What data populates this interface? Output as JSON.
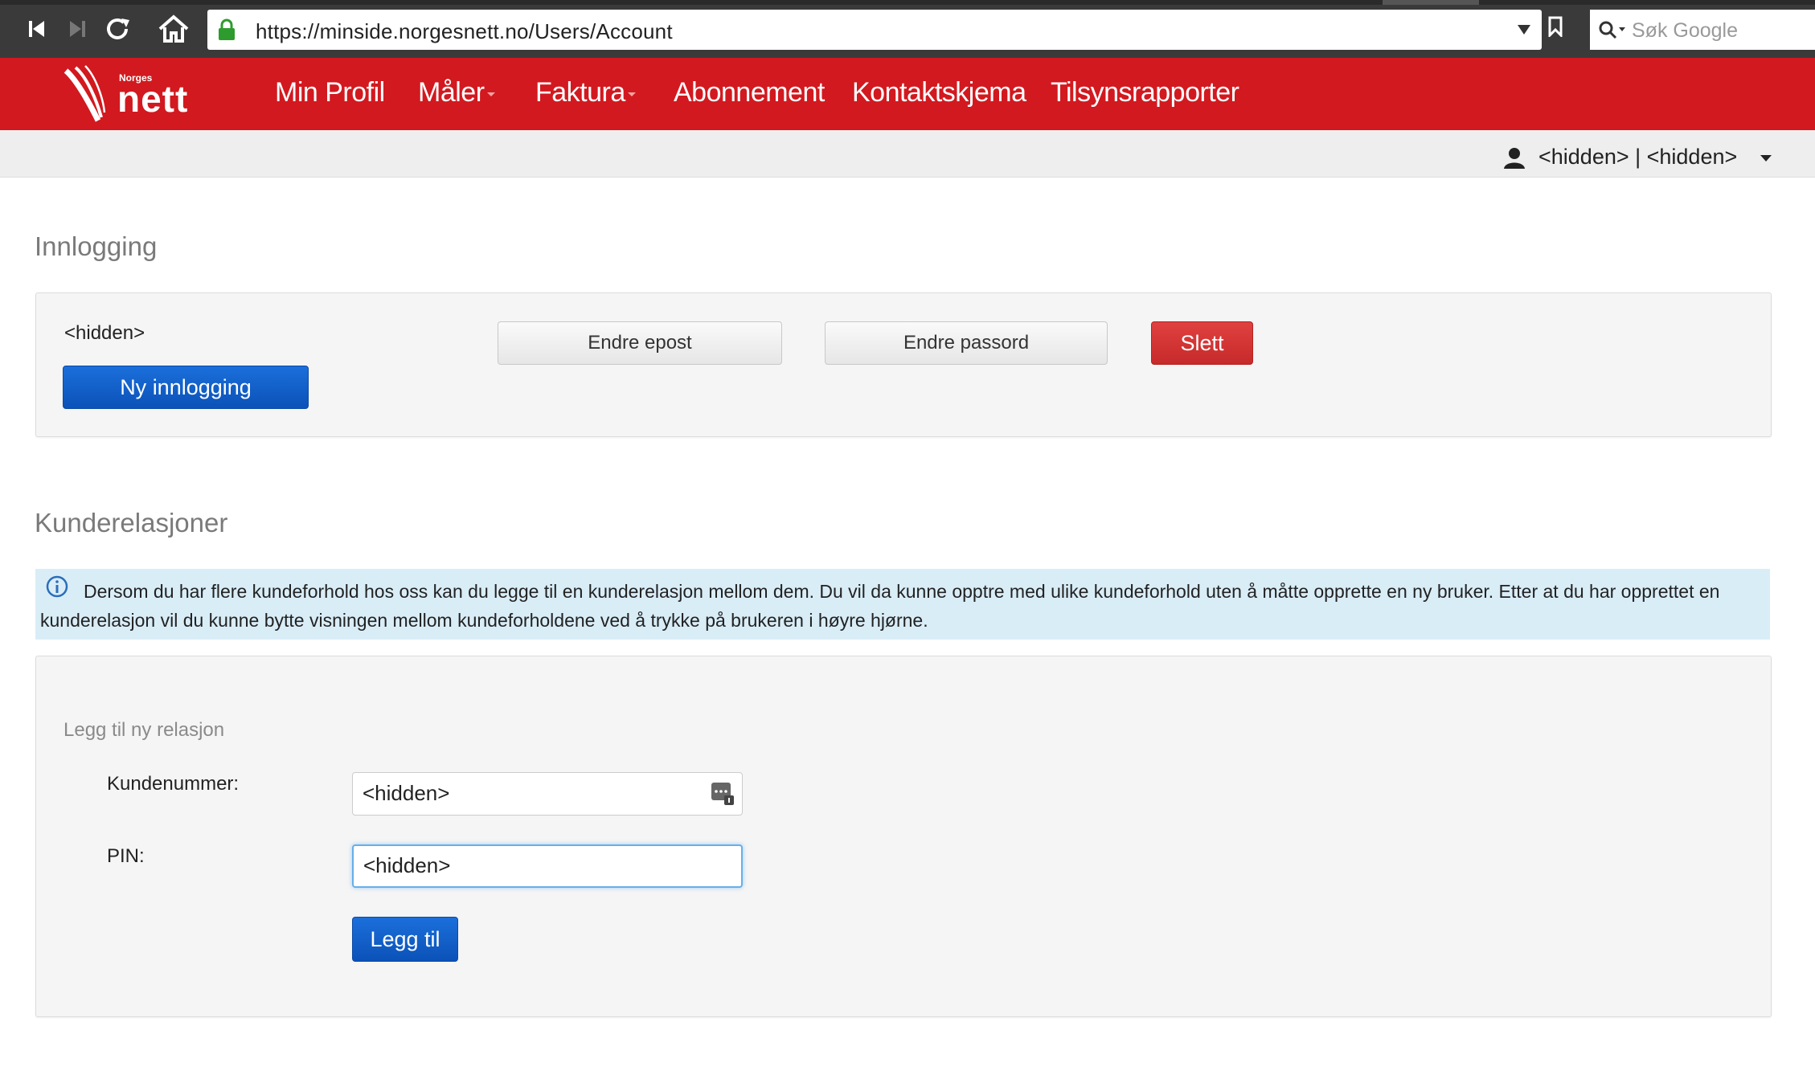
{
  "browser": {
    "url": "https://minside.norgesnett.no/Users/Account",
    "search_placeholder": "Søk Google"
  },
  "brand": {
    "logo_small": "Norges",
    "logo_large": "nett",
    "accent_color": "#d2191f"
  },
  "nav": {
    "items": [
      {
        "label": "Min Profil",
        "dropdown": false
      },
      {
        "label": "Måler",
        "dropdown": true
      },
      {
        "label": "Faktura",
        "dropdown": true
      },
      {
        "label": "Abonnement",
        "dropdown": false
      },
      {
        "label": "Kontaktskjema",
        "dropdown": false
      },
      {
        "label": "Tilsynsrapporter",
        "dropdown": false
      }
    ]
  },
  "user": {
    "label": "<hidden> | <hidden>"
  },
  "login_section": {
    "title": "Innlogging",
    "email": "<hidden>",
    "new_login_button": "Ny innlogging",
    "change_email_button": "Endre epost",
    "change_password_button": "Endre passord",
    "delete_button": "Slett"
  },
  "relations_section": {
    "title": "Kunderelasjoner",
    "info_text": "Dersom du har flere kundeforhold hos oss kan du legge til en kunderelasjon mellom dem. Du vil da kunne opptre med ulike kundeforhold uten å måtte opprette en ny bruker. Etter at du har opprettet en kunderelasjon vil du kunne bytte visningen mellom kundeforholdene ved å trykke på brukeren i høyre hjørne.",
    "form": {
      "legend": "Legg til ny relasjon",
      "customer_number_label": "Kundenummer:",
      "customer_number_value": "<hidden>",
      "pin_label": "PIN:",
      "pin_value": "<hidden>",
      "submit_button": "Legg til"
    }
  }
}
